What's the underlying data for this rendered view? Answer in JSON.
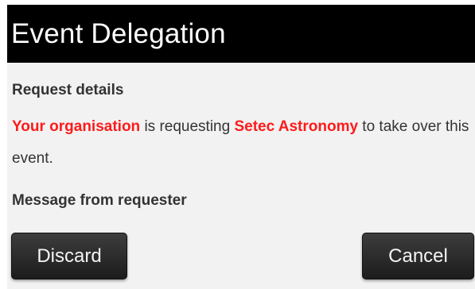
{
  "dialog": {
    "title": "Event Delegation",
    "request_heading": "Request details",
    "requester_org": "Your organisation",
    "request_verb": " is requesting ",
    "target_org": "Setec Astronomy",
    "request_suffix": " to take over this event.",
    "message_heading": "Message from requester"
  },
  "buttons": {
    "discard_label": "Discard",
    "cancel_label": "Cancel"
  },
  "colors": {
    "title_bg": "#000000",
    "highlight": "#ff1a1a",
    "body_bg": "#f2f2f2",
    "button_bg": "#2a2a2a"
  }
}
